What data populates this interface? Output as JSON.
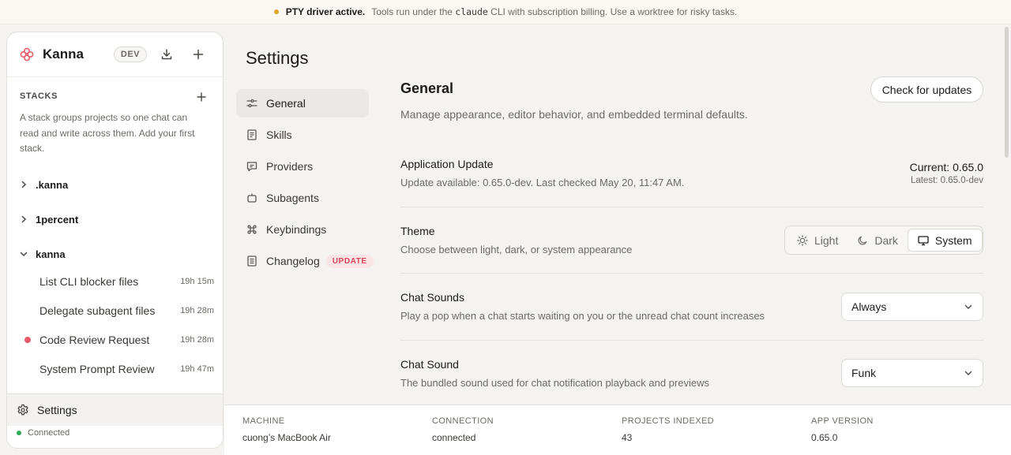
{
  "banner": {
    "strong": "PTY driver active.",
    "text_before": "Tools run under the",
    "code": "claude",
    "text_after": "CLI with subscription billing. Use a worktree for risky tasks."
  },
  "sidebar": {
    "brand": "Kanna",
    "badge": "DEV",
    "stacks_title": "STACKS",
    "stacks_desc": "A stack groups projects so one chat can read and write across them. Add your first stack.",
    "groups": [
      {
        "label": ".kanna",
        "expanded": false
      },
      {
        "label": "1percent",
        "expanded": false
      },
      {
        "label": "kanna",
        "expanded": true
      }
    ],
    "chats": [
      {
        "label": "List CLI blocker files",
        "time": "19h 15m",
        "unread": false
      },
      {
        "label": "Delegate subagent files",
        "time": "19h 28m",
        "unread": false
      },
      {
        "label": "Code Review Request",
        "time": "19h 28m",
        "unread": true
      },
      {
        "label": "System Prompt Review",
        "time": "19h 47m",
        "unread": false
      }
    ],
    "settings_label": "Settings",
    "connection_status": "Connected"
  },
  "settings": {
    "title": "Settings",
    "nav": [
      {
        "label": "General",
        "icon": "sliders-icon",
        "active": true
      },
      {
        "label": "Skills",
        "icon": "book-icon"
      },
      {
        "label": "Providers",
        "icon": "chat-bubble-icon"
      },
      {
        "label": "Subagents",
        "icon": "robot-icon"
      },
      {
        "label": "Keybindings",
        "icon": "command-icon"
      },
      {
        "label": "Changelog",
        "icon": "document-icon",
        "badge": "UPDATE"
      }
    ],
    "section_title": "General",
    "section_desc": "Manage appearance, editor behavior, and embedded terminal defaults.",
    "check_updates_label": "Check for updates",
    "app_update": {
      "title": "Application Update",
      "desc": "Update available: 0.65.0-dev. Last checked May 20, 11:47 AM.",
      "current": "Current: 0.65.0",
      "latest": "Latest: 0.65.0-dev"
    },
    "theme": {
      "title": "Theme",
      "desc": "Choose between light, dark, or system appearance",
      "options": [
        "Light",
        "Dark",
        "System"
      ],
      "selected": "System"
    },
    "chat_sounds": {
      "title": "Chat Sounds",
      "desc": "Play a pop when a chat starts waiting on you or the unread chat count increases",
      "value": "Always"
    },
    "chat_sound": {
      "title": "Chat Sound",
      "desc": "The bundled sound used for chat notification playback and previews",
      "value": "Funk"
    }
  },
  "footer": {
    "machine_label": "MACHINE",
    "machine_value": "cuong’s MacBook Air",
    "connection_label": "CONNECTION",
    "connection_value": "connected",
    "projects_label": "PROJECTS INDEXED",
    "projects_value": "43",
    "version_label": "APP VERSION",
    "version_value": "0.65.0"
  },
  "colors": {
    "accent_red": "#e95b6b",
    "status_green": "#2eaa57",
    "banner_dot": "#e0a32e"
  }
}
